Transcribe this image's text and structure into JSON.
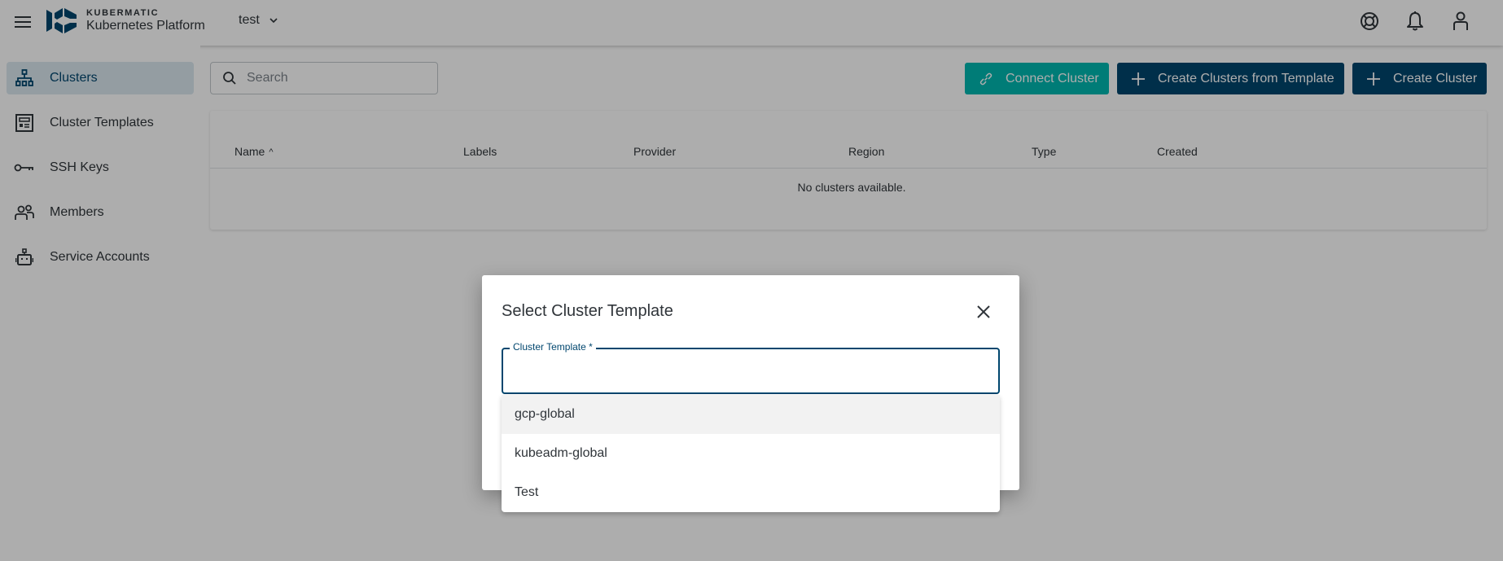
{
  "header": {
    "brand_top": "KUBERMATIC",
    "brand_bottom": "Kubernetes Platform",
    "project": "test",
    "icons": [
      "menu-icon",
      "help-lifebuoy-icon",
      "bell-icon",
      "user-icon"
    ]
  },
  "sidebar": {
    "items": [
      {
        "label": "Clusters",
        "icon": "sitemap-icon",
        "active": true
      },
      {
        "label": "Cluster Templates",
        "icon": "template-icon",
        "active": false
      },
      {
        "label": "SSH Keys",
        "icon": "key-icon",
        "active": false
      },
      {
        "label": "Members",
        "icon": "members-icon",
        "active": false
      },
      {
        "label": "Service Accounts",
        "icon": "robot-icon",
        "active": false
      }
    ]
  },
  "toolbar": {
    "search_placeholder": "Search",
    "connect_label": "Connect Cluster",
    "create_from_template_label": "Create Clusters from Template",
    "create_label": "Create Cluster"
  },
  "table": {
    "columns": [
      "Name",
      "Labels",
      "Provider",
      "Region",
      "Type",
      "Created"
    ],
    "sorted_column": "Name",
    "sort_direction": "ascending",
    "empty_message": "No clusters available."
  },
  "dialog": {
    "title": "Select Cluster Template",
    "field_label": "Cluster Template *",
    "field_value": "",
    "options": [
      "gcp-global",
      "kubeadm-global",
      "Test"
    ],
    "highlighted_option": "gcp-global"
  },
  "colors": {
    "primary": "#00466e",
    "accent_teal": "#00b7b0",
    "active_nav_bg": "#dbe7ef",
    "text": "#30353a"
  }
}
